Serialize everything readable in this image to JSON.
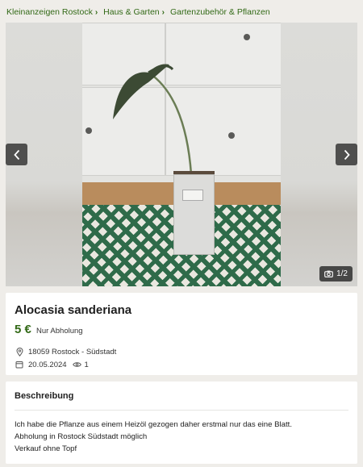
{
  "breadcrumb": [
    {
      "label": "Kleinanzeigen Rostock"
    },
    {
      "label": "Haus & Garten"
    },
    {
      "label": "Gartenzubehör & Pflanzen"
    }
  ],
  "gallery": {
    "counter": "1/2",
    "icons": {
      "prev": "chevron-left-icon",
      "next": "chevron-right-icon",
      "camera": "camera-icon"
    }
  },
  "listing": {
    "title": "Alocasia sanderiana",
    "price": "5 €",
    "shipping": "Nur Abholung",
    "location": "18059 Rostock - Südstadt",
    "date": "20.05.2024",
    "views": "1"
  },
  "description": {
    "heading": "Beschreibung",
    "lines": [
      "Ich habe die Pflanze aus einem Heizöl gezogen daher erstmal nur das eine Blatt.",
      "Abholung in Rostock Südstadt möglich",
      "Verkauf ohne Topf"
    ]
  },
  "colors": {
    "accent": "#326916",
    "background": "#efede9",
    "card": "#ffffff",
    "overlay": "#282828"
  }
}
